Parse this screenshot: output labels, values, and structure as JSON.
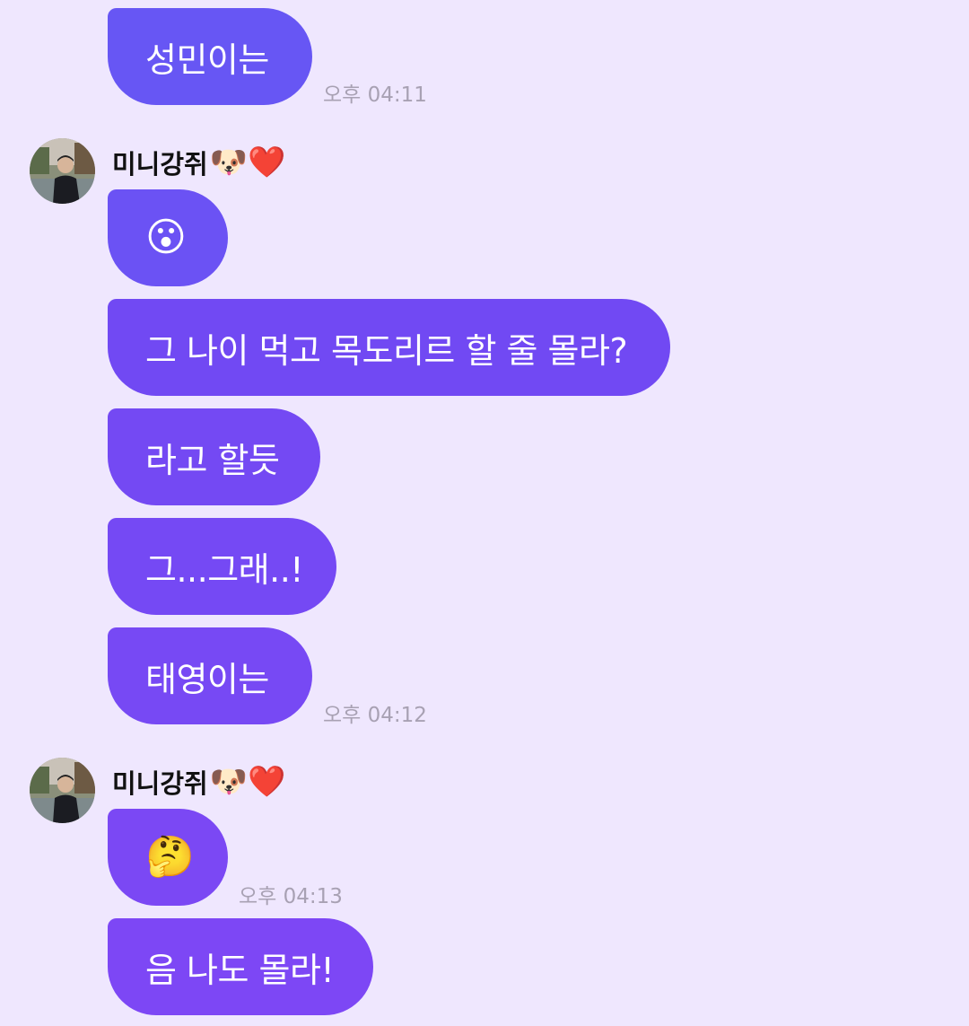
{
  "colors": {
    "background": "#efe7fe",
    "bubble_purple_light": "#6855f4",
    "bubble_purple": "#7447f3",
    "bubble_purple_deep": "#7d47f5",
    "timestamp": "#a8a1b3"
  },
  "messages": [
    {
      "text": "성민이는",
      "time": "오후 04:11"
    },
    {
      "sender": "미니강쥐🐶❤️"
    },
    {
      "text": "😮"
    },
    {
      "text": "그 나이 먹고 목도리르 할 줄 몰라?"
    },
    {
      "text": "라고 할듯"
    },
    {
      "text": "그...그래..!"
    },
    {
      "text": "태영이는",
      "time": "오후 04:12"
    },
    {
      "sender": "미니강쥐🐶❤️"
    },
    {
      "text": "🤔",
      "time": "오후 04:13"
    },
    {
      "text": "음 나도 몰라!"
    }
  ],
  "sender": {
    "name": "미니강쥐",
    "name_emojis": "🐶❤️",
    "avatar_icon": "profile-photo"
  }
}
